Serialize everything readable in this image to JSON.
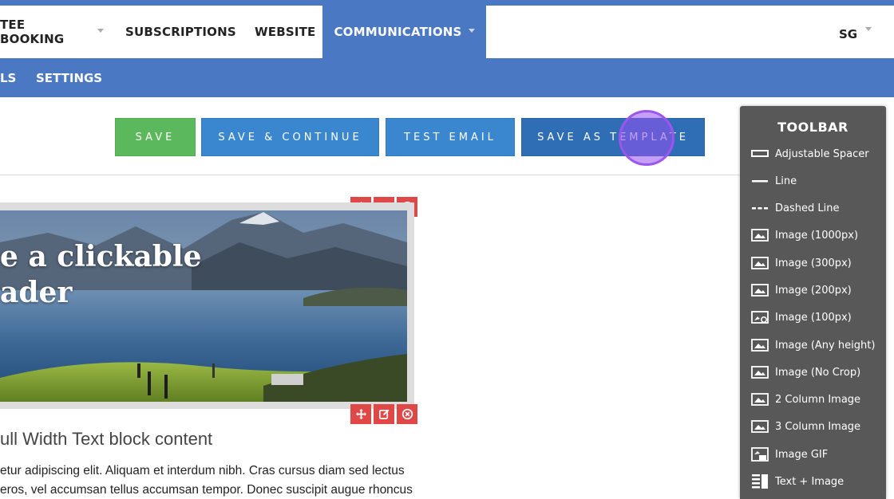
{
  "nav": {
    "items": [
      {
        "label": "TEE BOOKING",
        "dropdown": true
      },
      {
        "label": "SUBSCRIPTIONS",
        "dropdown": false
      },
      {
        "label": "WEBSITE",
        "dropdown": false
      },
      {
        "label": "COMMUNICATIONS",
        "dropdown": true,
        "active": true
      }
    ],
    "user_initials": "SG"
  },
  "subnav": {
    "items": [
      {
        "label": "LS"
      },
      {
        "label": "SETTINGS"
      }
    ]
  },
  "actions": {
    "save": "SAVE",
    "save_continue": "SAVE & CONTINUE",
    "test_email": "TEST EMAIL",
    "save_template": "SAVE AS TEMPLATE"
  },
  "editor": {
    "hero_title": "e a clickable\nader",
    "text_heading": "ull Width Text block content",
    "text_lines": [
      "etur adipiscing elit. Aliquam et interdum nibh. Cras cursus diam sed lectus",
      "eros, vel accumsan tellus accumsan tempor. Donec suscipit augue rhoncus"
    ]
  },
  "toolbar": {
    "title": "TOOLBAR",
    "items": [
      {
        "label": "Adjustable Spacer",
        "icon": "spacer-icon"
      },
      {
        "label": "Line",
        "icon": "line-icon"
      },
      {
        "label": "Dashed Line",
        "icon": "dashed-line-icon"
      },
      {
        "label": "Image (1000px)",
        "icon": "image-icon"
      },
      {
        "label": "Image (300px)",
        "icon": "image-icon"
      },
      {
        "label": "Image (200px)",
        "icon": "image-icon"
      },
      {
        "label": "Image (100px)",
        "icon": "image-small-icon"
      },
      {
        "label": "Image (Any height)",
        "icon": "image-icon"
      },
      {
        "label": "Image (No Crop)",
        "icon": "image-icon"
      },
      {
        "label": "2 Column Image",
        "icon": "image-icon"
      },
      {
        "label": "3 Column Image",
        "icon": "image-icon"
      },
      {
        "label": "Image GIF",
        "icon": "image-gif-icon"
      },
      {
        "label": "Text + Image",
        "icon": "text-image-icon"
      }
    ]
  },
  "colors": {
    "brand_blue": "#4a78c2",
    "save_green": "#5cb85c",
    "button_blue": "#3a87cf",
    "control_red": "#e04848",
    "toolbar_gray": "#585858"
  }
}
